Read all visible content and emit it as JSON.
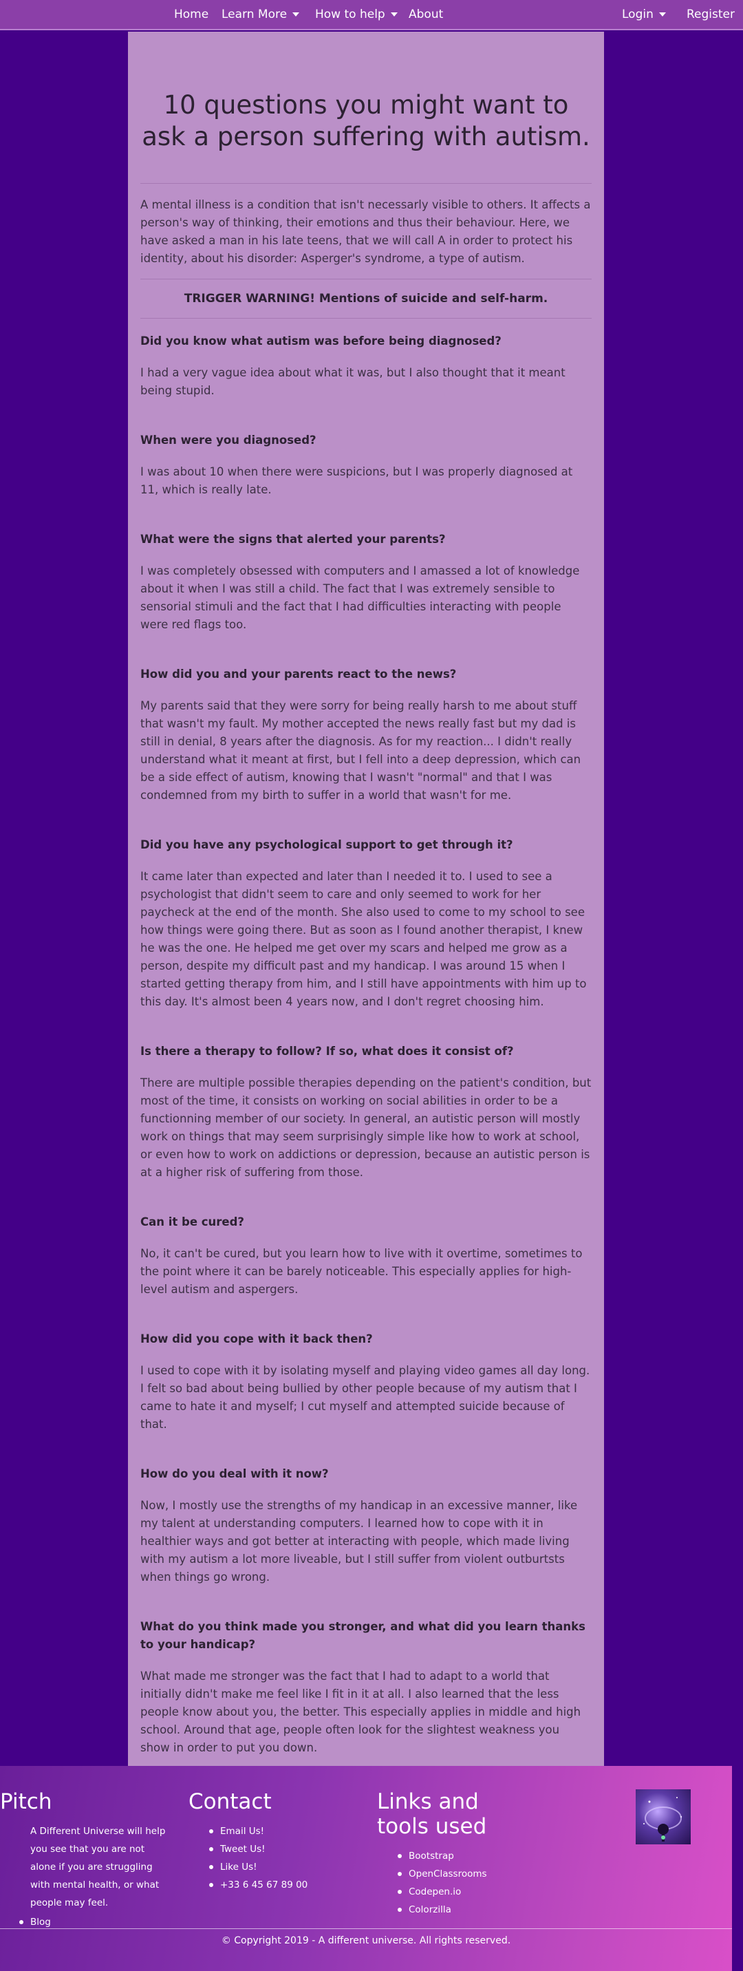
{
  "nav": {
    "home": "Home",
    "learn_more": "Learn More",
    "how_to_help": "How to help",
    "about": "About",
    "login": "Login",
    "register": "Register"
  },
  "article": {
    "title": "10 questions you might want to ask a person suffering with autism.",
    "intro": "A mental illness is a condition that isn't necessarly visible to others. It affects a person's way of thinking, their emotions and thus their behaviour. Here, we have asked a man in his late teens, that we will call A in order to protect his identity, about his disorder: Asperger's syndrome, a type of autism.",
    "warning": "TRIGGER WARNING! Mentions of suicide and self-harm.",
    "qa": [
      {
        "q": "Did you know what autism was before being diagnosed?",
        "a": "I had a very vague idea about what it was, but I also thought that it meant being stupid."
      },
      {
        "q": "When were you diagnosed?",
        "a": "I was about 10 when there were suspicions, but I was properly diagnosed at 11, which is really late."
      },
      {
        "q": "What were the signs that alerted your parents?",
        "a": "I was completely obsessed with computers and I amassed a lot of knowledge about it when I was still a child. The fact that I was extremely sensible to sensorial stimuli and the fact that I had difficulties interacting with people were red flags too."
      },
      {
        "q": "How did you and your parents react to the news?",
        "a": "My parents said that they were sorry for being really harsh to me about stuff that wasn't my fault. My mother accepted the news really fast but my dad is still in denial, 8 years after the diagnosis. As for my reaction... I didn't really understand what it meant at first, but I fell into a deep depression, which can be a side effect of autism, knowing that I wasn't \"normal\" and that I was condemned from my birth to suffer in a world that wasn't for me."
      },
      {
        "q": "Did you have any psychological support to get through it?",
        "a": "It came later than expected and later than I needed it to. I used to see a psychologist that didn't seem to care and only seemed to work for her paycheck at the end of the month. She also used to come to my school to see how things were going there. But as soon as I found another therapist, I knew he was the one. He helped me get over my scars and helped me grow as a person, despite my difficult past and my handicap. I was around 15 when I started getting therapy from him, and I still have appointments with him up to this day. It's almost been 4 years now, and I don't regret choosing him."
      },
      {
        "q": "Is there a therapy to follow? If so, what does it consist of?",
        "a": "There are multiple possible therapies depending on the patient's condition, but most of the time, it consists on working on social abilities in order to be a functionning member of our society. In general, an autistic person will mostly work on things that may seem surprisingly simple like how to work at school, or even how to work on addictions or depression, because an autistic person is at a higher risk of suffering from those."
      },
      {
        "q": "Can it be cured?",
        "a": "No, it can't be cured, but you learn how to live with it overtime, sometimes to the point where it can be barely noticeable. This especially applies for high-level autism and aspergers."
      },
      {
        "q": "How did you cope with it back then?",
        "a": "I used to cope with it by isolating myself and playing video games all day long. I felt so bad about being bullied by other people because of my autism that I came to hate it and myself; I cut myself and attempted suicide because of that."
      },
      {
        "q": "How do you deal with it now?",
        "a": "Now, I mostly use the strengths of my handicap in an excessive manner, like my talent at understanding computers. I learned how to cope with it in healthier ways and got better at interacting with people, which made living with my autism a lot more liveable, but I still suffer from violent outburtsts when things go wrong."
      },
      {
        "q": "What do you think made you stronger, and what did you learn thanks to your handicap?",
        "a": "What made me stronger was the fact that I had to adapt to a world that initially didn't make me feel like I fit in it at all. I also learned that the less people know about you, the better. This especially applies in middle and high school. Around that age, people often look for the slightest weakness you show in order to put you down."
      }
    ]
  },
  "footer": {
    "pitch": {
      "title": "Pitch",
      "text": "A Different Universe will help you see that you are not alone if you are struggling with mental health, or what people may feel.",
      "blog": "Blog"
    },
    "contact": {
      "title": "Contact",
      "items": [
        "Email Us!",
        "Tweet Us!",
        "Like Us!",
        "+33 6 45 67 89 00"
      ]
    },
    "links": {
      "title": "Links and tools used",
      "items": [
        "Bootstrap",
        "OpenClassrooms",
        "Codepen.io",
        "Colorzilla"
      ]
    },
    "copyright": "© Copyright 2019 - A different universe. All rights reserved."
  },
  "colors": {
    "background": "#440088",
    "navbar": "#8b3fa8",
    "article_bg": "#bb90c8",
    "footer_start": "#6a1f9a",
    "footer_end": "#d94fc8"
  }
}
